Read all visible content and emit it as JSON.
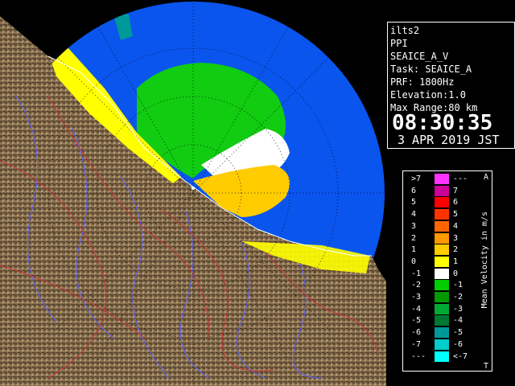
{
  "info": {
    "station": "ilts2",
    "scan_type": "PPI",
    "product": "SEAICE_A_V",
    "task": "Task: SEAICE_A",
    "prf": "PRF: 1800Hz",
    "elevation": "Elevation:1.0",
    "max_range": "Max Range:80 km",
    "time": "08:30:35",
    "date": "3 APR 2019 JST"
  },
  "legend": {
    "title": "Mean Velocity in m/s",
    "corner_top": "A",
    "corner_bottom": "T",
    "rows": [
      {
        "left": ">7",
        "right": "---",
        "color": "#ff33ff"
      },
      {
        "left": "6",
        "right": "7",
        "color": "#cc0099"
      },
      {
        "left": "5",
        "right": "6",
        "color": "#ff0000"
      },
      {
        "left": "4",
        "right": "5",
        "color": "#ff3300"
      },
      {
        "left": "3",
        "right": "4",
        "color": "#ff6600"
      },
      {
        "left": "2",
        "right": "3",
        "color": "#ff9900"
      },
      {
        "left": "1",
        "right": "2",
        "color": "#ffcc00"
      },
      {
        "left": "0",
        "right": "1",
        "color": "#ffff00"
      },
      {
        "left": "-1",
        "right": "0",
        "color": "#ffffff"
      },
      {
        "left": "-2",
        "right": "-1",
        "color": "#00cc00"
      },
      {
        "left": "-3",
        "right": "-2",
        "color": "#009900"
      },
      {
        "left": "-4",
        "right": "-3",
        "color": "#00aa33"
      },
      {
        "left": "-5",
        "right": "-4",
        "color": "#007733"
      },
      {
        "left": "-6",
        "right": "-5",
        "color": "#009999"
      },
      {
        "left": "-7",
        "right": "-6",
        "color": "#00cccc"
      },
      {
        "left": "---",
        "right": "<-7",
        "color": "#00ffff"
      }
    ]
  },
  "colors": {
    "sea": "#0a55ee",
    "land": "#8a7150",
    "outside": "#000000",
    "rivers": "#5566ff",
    "borders": "#cc3333"
  }
}
